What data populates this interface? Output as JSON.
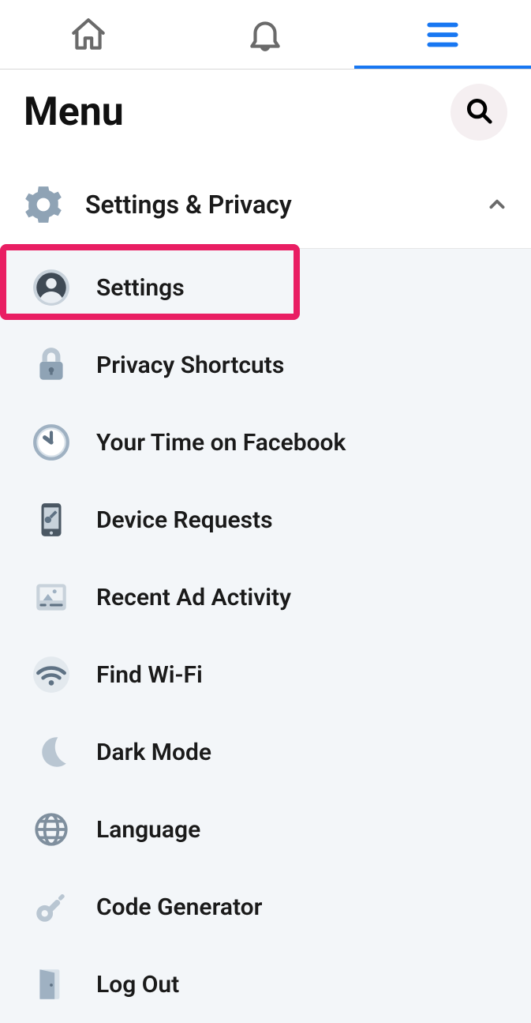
{
  "header": {
    "title": "Menu"
  },
  "section": {
    "label": "Settings & Privacy"
  },
  "items": [
    {
      "label": "Settings"
    },
    {
      "label": "Privacy Shortcuts"
    },
    {
      "label": "Your Time on Facebook"
    },
    {
      "label": "Device Requests"
    },
    {
      "label": "Recent Ad Activity"
    },
    {
      "label": "Find Wi-Fi"
    },
    {
      "label": "Dark Mode"
    },
    {
      "label": "Language"
    },
    {
      "label": "Code Generator"
    },
    {
      "label": "Log Out"
    }
  ]
}
